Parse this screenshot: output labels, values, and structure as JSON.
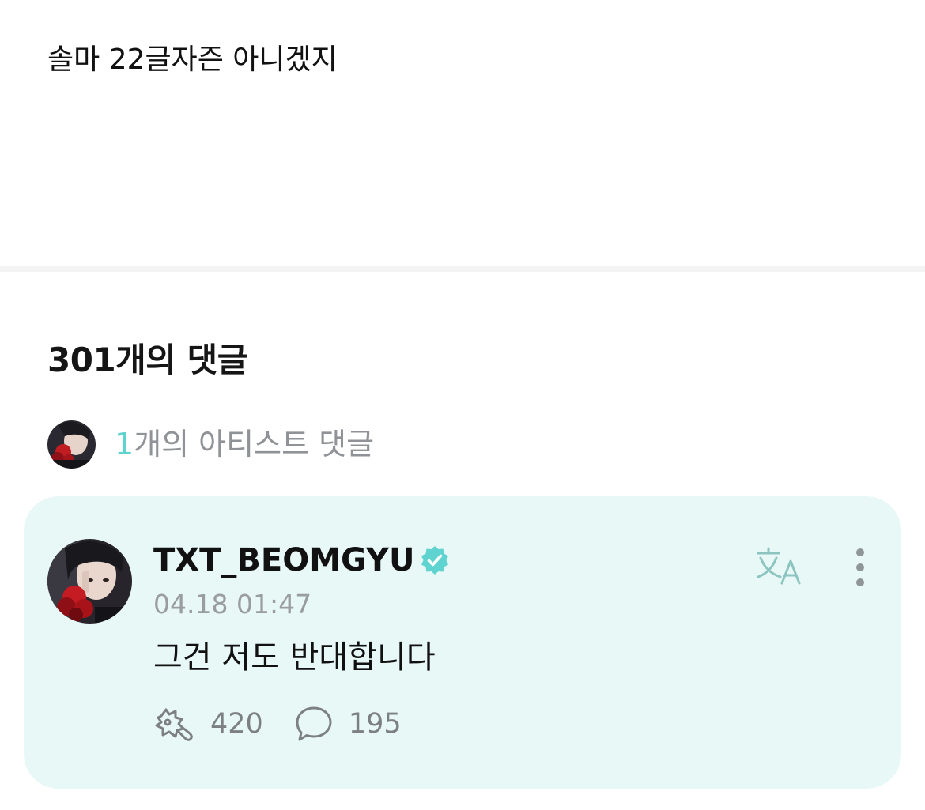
{
  "post": {
    "body": "솔마 22글자즌 아니겠지"
  },
  "comments": {
    "title": "301개의 댓글",
    "artist_summary": {
      "count": "1",
      "label": "개의 아티스트 댓글",
      "avatar_icon": "artist-avatar"
    }
  },
  "comment": {
    "author": "TXT_BEOMGYU",
    "verified_icon": "verified-badge-icon",
    "timestamp": "04.18 01:47",
    "text": "그건 저도 반대합니다",
    "translate_icon": "translate-icon",
    "more_icon": "more-vertical-icon",
    "likes": "420",
    "replies": "195",
    "accent_color": "#5fd3d0",
    "card_color": "#e8f8f6"
  }
}
